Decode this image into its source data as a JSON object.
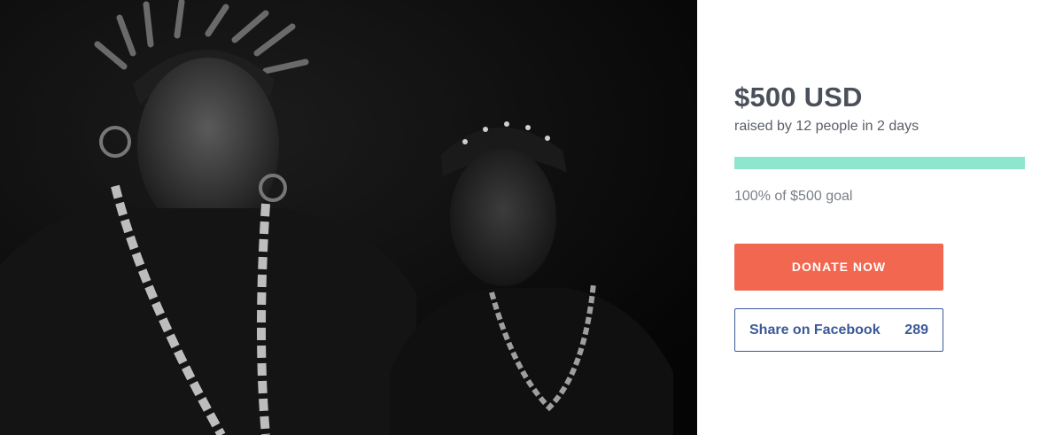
{
  "campaign": {
    "amount": "$500 USD",
    "raised_text": "raised by 12 people in 2 days",
    "goal_text": "100% of $500 goal",
    "progress_fraction": 1.0,
    "progress_color": "#8fe6cf"
  },
  "actions": {
    "donate_label": "DONATE NOW",
    "donate_color": "#f2674f",
    "share_label": "Share on Facebook",
    "share_count": "289",
    "share_color": "#3b5998"
  }
}
